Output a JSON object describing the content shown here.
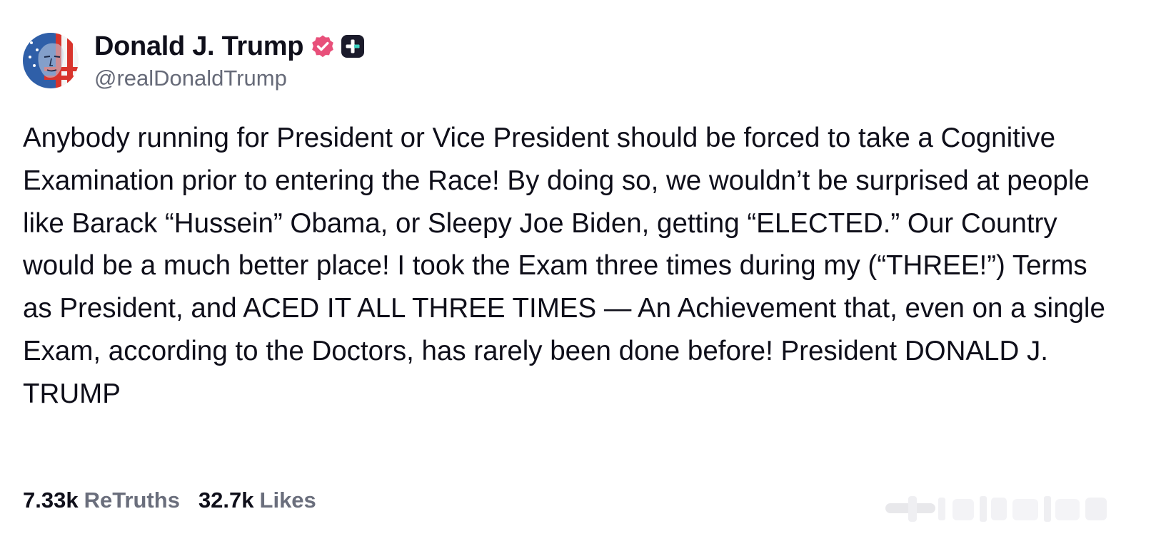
{
  "author": {
    "display_name": "Donald J. Trump",
    "handle": "@realDonaldTrump",
    "avatar_icon": "avatar-portrait-flag",
    "verified_icon": "verified-badge-icon",
    "verified_color": "#e8507a",
    "plus_icon": "plus-badge-icon"
  },
  "post": {
    "text": "Anybody running for President or Vice President should be forced to take a Cognitive Examination prior to entering the Race! By doing so, we wouldn’t be surprised at people like Barack “Hussein” Obama, or Sleepy Joe Biden, getting “ELECTED.” Our Country would be a much better place! I took the Exam three times during my (“THREE!”) Terms as President, and ACED IT ALL THREE TIMES — An Achievement that, even on a single Exam, according to the Doctors, has rarely been done before! President DONALD J. TRUMP"
  },
  "stats": {
    "retruths_count": "7.33k",
    "retruths_label": "ReTruths",
    "likes_count": "32.7k",
    "likes_label": "Likes"
  }
}
